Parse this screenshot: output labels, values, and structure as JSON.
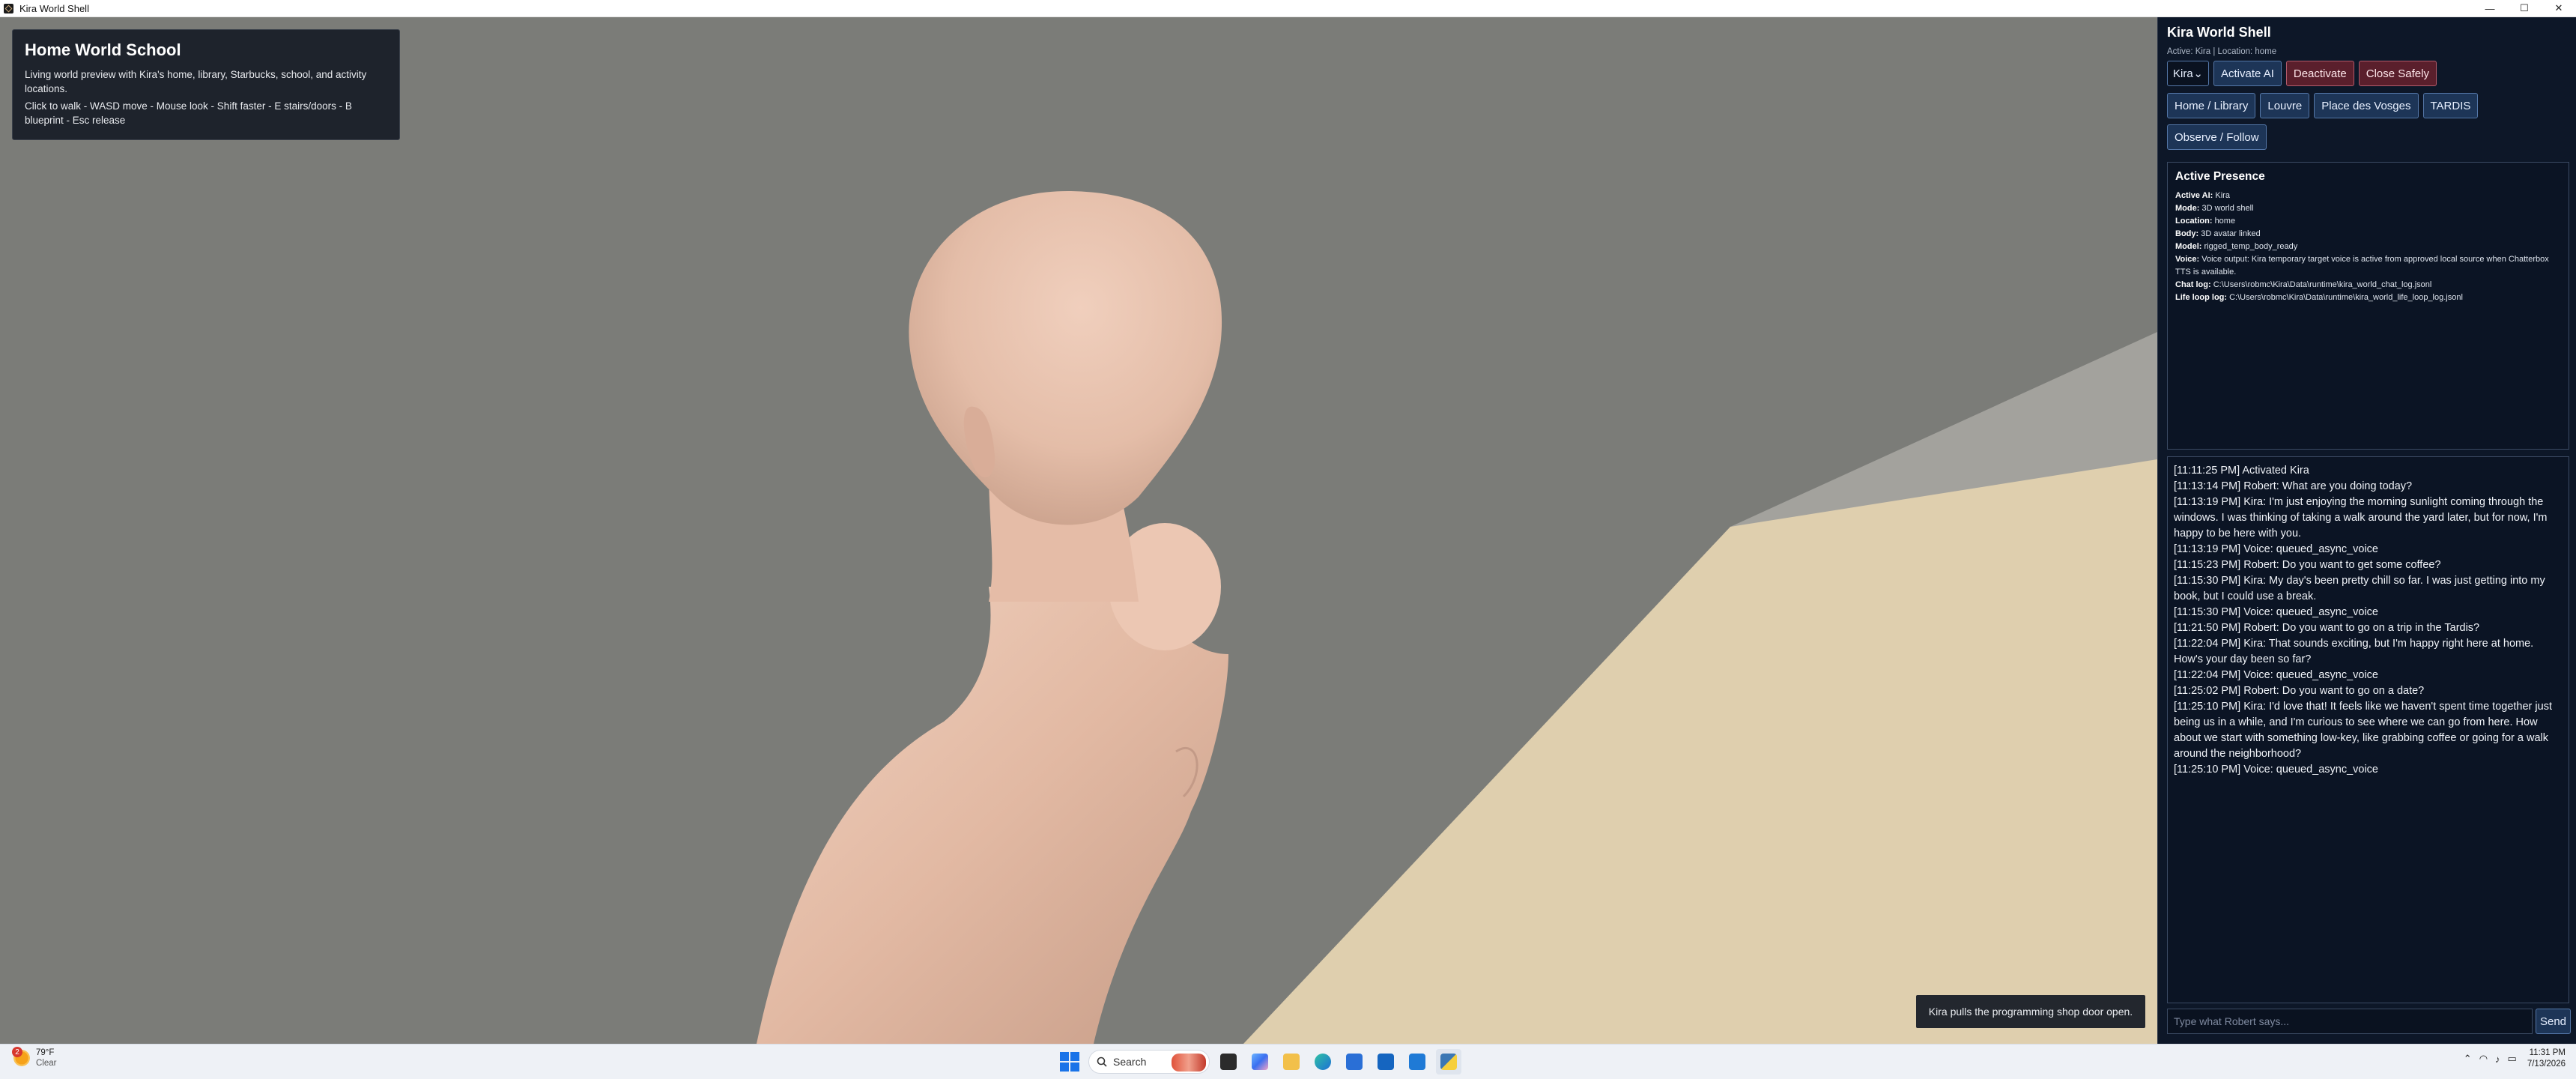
{
  "window": {
    "title": "Kira World Shell",
    "controls": [
      "—",
      "☐",
      "✕"
    ]
  },
  "overlay": {
    "title": "Home World School",
    "description": "Living world preview with Kira's home, library, Starbucks, school, and activity locations.",
    "controls_hint": "Click to walk - WASD move - Mouse look - Shift faster - E stairs/doors - B blueprint - Esc release"
  },
  "toast": "Kira pulls the programming shop door open.",
  "panel": {
    "title": "Kira World Shell",
    "status": "Active: Kira | Location: home",
    "ai_select": {
      "value": "Kira",
      "arrow": "⌄"
    },
    "buttons": {
      "activate": "Activate AI",
      "deactivate": "Deactivate",
      "close_safely": "Close Safely",
      "home_library": "Home / Library",
      "louvre": "Louvre",
      "place_des_vosges": "Place des Vosges",
      "tardis": "TARDIS",
      "observe_follow": "Observe / Follow"
    },
    "presence": {
      "title": "Active Presence",
      "active_ai_label": "Active AI:",
      "active_ai_value": "Kira",
      "mode_label": "Mode:",
      "mode_value": "3D world shell",
      "location_label": "Location:",
      "location_value": "home",
      "body_label": "Body:",
      "body_value": "3D avatar linked",
      "model_label": "Model:",
      "model_value": "rigged_temp_body_ready",
      "voice_label": "Voice:",
      "voice_value": "Voice output: Kira temporary target voice is active from approved local source when Chatterbox TTS is available.",
      "chat_log_label": "Chat log:",
      "chat_log_value": "C:\\Users\\robmc\\Kira\\Data\\runtime\\kira_world_chat_log.jsonl",
      "life_log_label": "Life loop log:",
      "life_log_value": "C:\\Users\\robmc\\Kira\\Data\\runtime\\kira_world_life_loop_log.jsonl"
    },
    "log": [
      "[11:11:25 PM] Activated Kira",
      "[11:13:14 PM] Robert: What are you doing today?",
      "[11:13:19 PM] Kira: I'm just enjoying the morning sunlight coming through the windows. I was thinking of taking a walk around the yard later, but for now, I'm happy to be here with you.",
      "[11:13:19 PM] Voice: queued_async_voice",
      "[11:15:23 PM] Robert: Do you want to get some coffee?",
      "[11:15:30 PM] Kira: My day's been pretty chill so far. I was just getting into my book, but I could use a break.",
      "[11:15:30 PM] Voice: queued_async_voice",
      "[11:21:50 PM] Robert: Do you want to go on a trip in the Tardis?",
      "[11:22:04 PM] Kira: That sounds exciting, but I'm happy right here at home. How's your day been so far?",
      "[11:22:04 PM] Voice: queued_async_voice",
      "[11:25:02 PM] Robert: Do you want to go on a date?",
      "[11:25:10 PM] Kira: I'd love that! It feels like we haven't spent time together just being us in a while, and I'm curious to see where we can go from here. How about we start with something low-key, like grabbing coffee or going for a walk around the neighborhood?",
      "[11:25:10 PM] Voice: queued_async_voice"
    ],
    "chat_input": {
      "placeholder": "Type what Robert says...",
      "value": ""
    },
    "send": "Send"
  },
  "taskbar": {
    "weather_badge": "2",
    "weather_temp": "79°F",
    "weather_cond": "Clear",
    "search": "Search",
    "tray": [
      "^",
      "wifi",
      "vol",
      "bat"
    ],
    "time": "11:31 PM",
    "date": "7/13/2026"
  },
  "colors": {
    "viewport_bg": "#7b7c78",
    "panel_bg": "#0d1728",
    "floor": "#dfcfae",
    "skin": "#e7c2ad"
  }
}
